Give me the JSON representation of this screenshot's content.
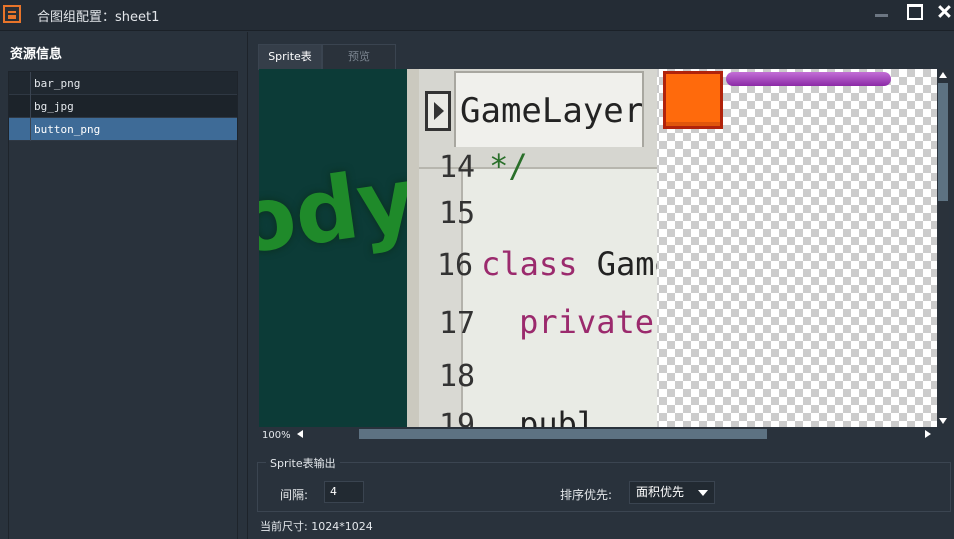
{
  "window": {
    "title": "合图组配置：sheet1",
    "controls": [
      "minimize-icon",
      "maximize-icon",
      "close-icon"
    ]
  },
  "sidebar": {
    "title": "资源信息",
    "items": [
      {
        "label": "bar_png",
        "selected": false
      },
      {
        "label": "bg_jpg",
        "selected": false
      },
      {
        "label": "button_png",
        "selected": true
      }
    ]
  },
  "tabs": [
    {
      "label": "Sprite表",
      "active": true
    },
    {
      "label": "预览",
      "active": false
    }
  ],
  "canvas": {
    "zoom": "100%",
    "bg_image": {
      "tab_title": "GameLayer.ts X",
      "lines": [
        {
          "num": "14",
          "code": "*/"
        },
        {
          "num": "15",
          "code": ""
        },
        {
          "num": "16",
          "keyword": "class",
          "code": " GameLayer"
        },
        {
          "num": "17",
          "keyword": "private stat",
          "code": ""
        },
        {
          "num": "18",
          "code": ""
        },
        {
          "num": "19",
          "code": "publ"
        }
      ],
      "green_text": "ody!"
    }
  },
  "output": {
    "legend": "Sprite表输出",
    "spacing_label": "间隔:",
    "spacing_value": "4",
    "sort_label": "排序优先:",
    "sort_value": "面积优先"
  },
  "status": {
    "size_text": "当前尺寸: 1024*1024"
  },
  "colors": {
    "accent_selected": "#3e6b97",
    "window_bg": "#29323c",
    "sprite_button": "#ff6a0c",
    "sprite_bar": "#9b35b5"
  }
}
